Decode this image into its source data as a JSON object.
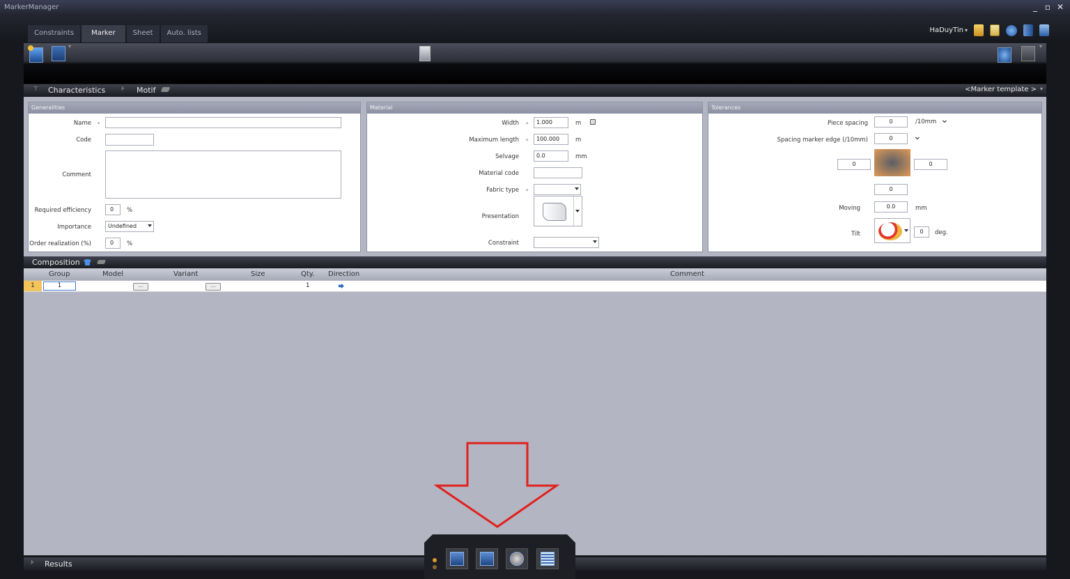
{
  "app": {
    "title": "MarkerManager"
  },
  "window_controls": {
    "minimize": "_",
    "maximize": "▫",
    "close": "✕"
  },
  "tabs": [
    {
      "label": "Constraints",
      "active": false
    },
    {
      "label": "Marker",
      "active": true
    },
    {
      "label": "Sheet",
      "active": false
    },
    {
      "label": "Auto. lists",
      "active": false
    }
  ],
  "user": {
    "name": "HaDuyTin"
  },
  "characteristics_bar": {
    "label": "Characteristics",
    "motif_label": "Motif",
    "template_label": "<Marker template >"
  },
  "generalities": {
    "title": "Generalities",
    "name_label": "Name",
    "name_value": "",
    "code_label": "Code",
    "code_value": "",
    "comment_label": "Comment",
    "comment_value": "",
    "required_efficiency_label": "Required efficiency",
    "required_efficiency_value": "0",
    "percent": "%",
    "importance_label": "Importance",
    "importance_value": "Undefined",
    "order_realization_label": "Order realization (%)",
    "order_realization_value": "0"
  },
  "material": {
    "title": "Material",
    "width_label": "Width",
    "width_value": "1.000",
    "width_unit": "m",
    "max_length_label": "Maximum length",
    "max_length_value": "100.000",
    "max_length_unit": "m",
    "selvage_label": "Selvage",
    "selvage_value": "0.0",
    "selvage_unit": "mm",
    "material_code_label": "Material code",
    "material_code_value": "",
    "fabric_type_label": "Fabric type",
    "fabric_type_value": "",
    "presentation_label": "Presentation",
    "constraint_label": "Constraint",
    "constraint_value": ""
  },
  "tolerances": {
    "title": "Tolerances",
    "piece_spacing_label": "Piece spacing",
    "piece_spacing_value": "0",
    "piece_spacing_unit": "/10mm",
    "spacing_marker_edge_label": "Spacing marker edge (/10mm)",
    "spacing_marker_edge_value": "0",
    "left_value": "0",
    "right_value": "0",
    "bottom_value": "0",
    "moving_label": "Moving",
    "moving_value": "0.0",
    "moving_unit": "mm",
    "tilt_label": "Tilt",
    "tilt_value": "0",
    "tilt_unit": "deg."
  },
  "composition": {
    "label": "Composition",
    "columns": [
      "Group",
      "Model",
      "Variant",
      "Size",
      "Qty.",
      "Direction",
      "Comment"
    ],
    "rows": [
      {
        "index": "1",
        "group": "1",
        "model_btn": "...",
        "variant_btn": "...",
        "qty": "1"
      }
    ]
  },
  "results": {
    "label": "Results"
  },
  "colors": {
    "accent_red": "#e0201c",
    "panel_header": "#9297a8",
    "row_highlight": "#f4c45a"
  }
}
